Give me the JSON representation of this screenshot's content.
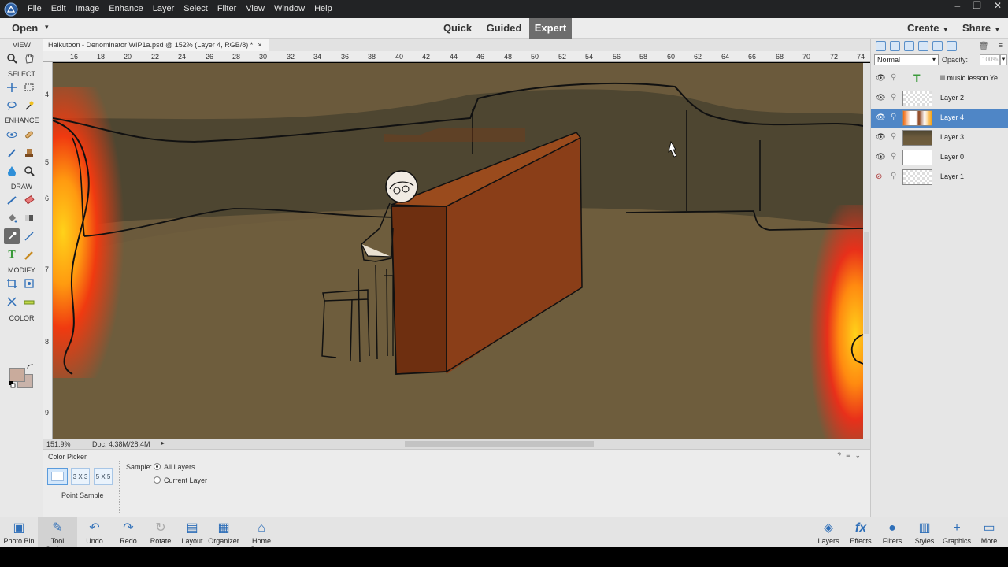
{
  "menubar": {
    "items": [
      "File",
      "Edit",
      "Image",
      "Enhance",
      "Layer",
      "Select",
      "Filter",
      "View",
      "Window",
      "Help"
    ]
  },
  "modebar": {
    "open": "Open",
    "tabs": [
      "Quick",
      "Guided",
      "Expert"
    ],
    "active_tab": "Expert",
    "create": "Create",
    "share": "Share"
  },
  "toolbox": {
    "sections": [
      "VIEW",
      "SELECT",
      "ENHANCE",
      "DRAW",
      "MODIFY",
      "COLOR"
    ],
    "foreground_color": "#c9ab9c",
    "background_color": "#c9b3aa"
  },
  "document": {
    "tab_title": "Haikutoon - Denominator WIP1a.psd @ 152% (Layer 4, RGB/8) *",
    "ruler_h": [
      "16",
      "18",
      "20",
      "22",
      "24",
      "26",
      "28",
      "30",
      "32",
      "34",
      "36",
      "38",
      "40",
      "42",
      "44",
      "46",
      "48",
      "50",
      "52",
      "54",
      "56",
      "58",
      "60",
      "62",
      "64",
      "66",
      "68",
      "70",
      "72",
      "74"
    ],
    "ruler_v": [
      "4",
      "5",
      "6",
      "7",
      "8",
      "9"
    ]
  },
  "status": {
    "zoom": "151.9%",
    "doc_size": "Doc: 4.38M/28.4M"
  },
  "tool_options": {
    "title": "Color Picker",
    "sample_sizes": [
      "",
      "3 X 3",
      "5 X 5"
    ],
    "sample_caption": "Point Sample",
    "sample_label": "Sample:",
    "options": [
      "All Layers",
      "Current Layer"
    ]
  },
  "layers_panel": {
    "blend_mode": "Normal",
    "opacity_label": "Opacity:",
    "opacity_value": "100%",
    "layers": [
      {
        "name": "lil music lesson Ye...",
        "type": "text",
        "visible": true
      },
      {
        "name": "Layer 2",
        "type": "transparent",
        "visible": true
      },
      {
        "name": "Layer 4",
        "type": "art",
        "visible": true,
        "selected": true
      },
      {
        "name": "Layer 3",
        "type": "brown",
        "visible": true
      },
      {
        "name": "Layer 0",
        "type": "white",
        "visible": true
      },
      {
        "name": "Layer 1",
        "type": "transparent",
        "visible": false
      }
    ]
  },
  "taskbar": {
    "left": [
      "Photo Bin",
      "Tool Options",
      "Undo",
      "Redo",
      "Rotate",
      "Layout",
      "Organizer",
      "Home Screen"
    ],
    "right": [
      "Layers",
      "Effects",
      "Filters",
      "Styles",
      "Graphics",
      "More"
    ]
  }
}
